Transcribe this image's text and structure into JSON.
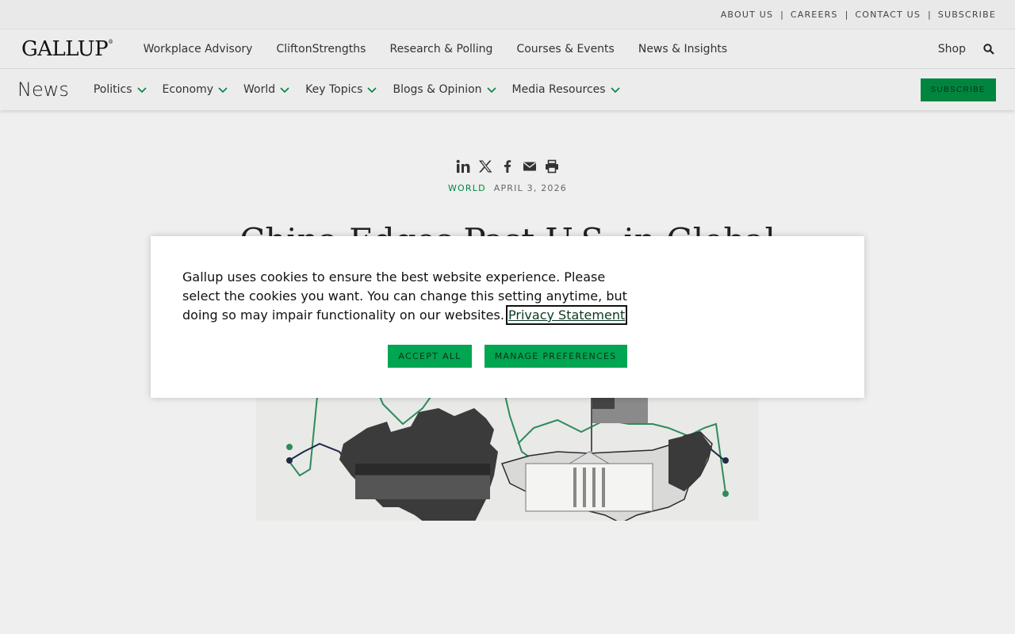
{
  "util_nav": [
    "ABOUT US",
    "CAREERS",
    "CONTACT US",
    "SUBSCRIBE"
  ],
  "util_sep": "|",
  "logo": {
    "text": "GALLUP",
    "mark": "®"
  },
  "main_nav": {
    "items": [
      "Workplace Advisory",
      "CliftonStrengths",
      "Research & Polling",
      "Courses & Events",
      "News & Insights"
    ],
    "shop": "Shop"
  },
  "news_nav": {
    "title": "News",
    "categories": [
      "Politics",
      "Economy",
      "World",
      "Key Topics",
      "Blogs & Opinion",
      "Media Resources"
    ],
    "subscribe": "SUBSCRIBE"
  },
  "article": {
    "category": "WORLD",
    "date": "APRIL 3, 2026",
    "headline": "China Edges Past U.S. in Global"
  },
  "cookie_dialog": {
    "text": "Gallup uses cookies to ensure the best website experience. Please select the cookies you want. You can change this setting anytime, but doing so may impair functionality on our websites.",
    "privacy_link": "Privacy Statement",
    "accept": "ACCEPT ALL",
    "manage": "MANAGE PREFERENCES"
  },
  "colors": {
    "brand_green": "#00a651",
    "dark_green": "#00853f"
  },
  "icons": [
    "linkedin-icon",
    "x-icon",
    "facebook-icon",
    "email-icon",
    "print-icon",
    "search-icon",
    "chevron-down-icon"
  ]
}
